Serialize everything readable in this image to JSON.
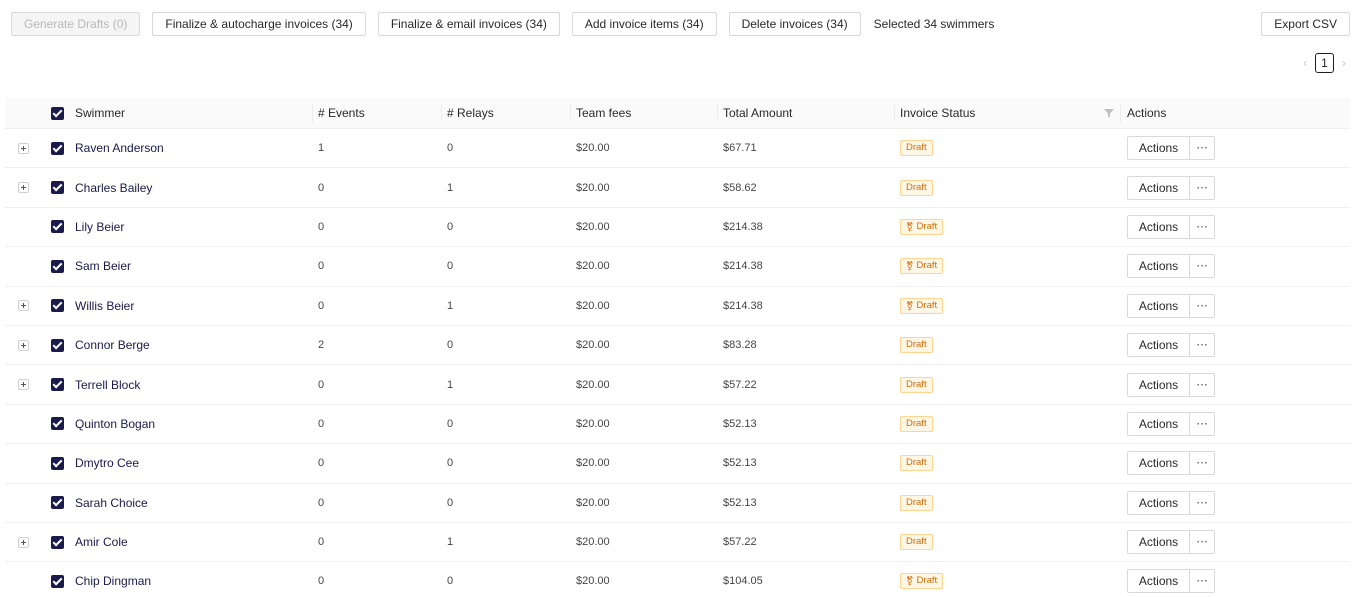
{
  "toolbar": {
    "generate_drafts": "Generate Drafts (0)",
    "finalize_autocharge": "Finalize & autocharge invoices (34)",
    "finalize_email": "Finalize & email invoices (34)",
    "add_items": "Add invoice items (34)",
    "delete_invoices": "Delete invoices (34)",
    "selected_text": "Selected 34 swimmers",
    "export_csv": "Export CSV"
  },
  "pagination": {
    "prev": "‹",
    "current_page": "1",
    "next": "›"
  },
  "table": {
    "columns": {
      "swimmer": "Swimmer",
      "events": "# Events",
      "relays": "# Relays",
      "team_fees": "Team fees",
      "total_amount": "Total Amount",
      "invoice_status": "Invoice Status",
      "actions": "Actions"
    },
    "rows": [
      {
        "expandable": true,
        "name": "Raven Anderson",
        "events": "1",
        "relays": "0",
        "fees": "$20.00",
        "total": "$67.71",
        "status": "Draft",
        "status_icon": false,
        "action": "Actions",
        "more": "···"
      },
      {
        "expandable": true,
        "name": "Charles Bailey",
        "events": "0",
        "relays": "1",
        "fees": "$20.00",
        "total": "$58.62",
        "status": "Draft",
        "status_icon": false,
        "action": "Actions",
        "more": "···"
      },
      {
        "expandable": false,
        "name": "Lily Beier",
        "events": "0",
        "relays": "0",
        "fees": "$20.00",
        "total": "$214.38",
        "status": "Draft",
        "status_icon": true,
        "action": "Actions",
        "more": "···"
      },
      {
        "expandable": false,
        "name": "Sam Beier",
        "events": "0",
        "relays": "0",
        "fees": "$20.00",
        "total": "$214.38",
        "status": "Draft",
        "status_icon": true,
        "action": "Actions",
        "more": "···"
      },
      {
        "expandable": true,
        "name": "Willis Beier",
        "events": "0",
        "relays": "1",
        "fees": "$20.00",
        "total": "$214.38",
        "status": "Draft",
        "status_icon": true,
        "action": "Actions",
        "more": "···"
      },
      {
        "expandable": true,
        "name": "Connor Berge",
        "events": "2",
        "relays": "0",
        "fees": "$20.00",
        "total": "$83.28",
        "status": "Draft",
        "status_icon": false,
        "action": "Actions",
        "more": "···"
      },
      {
        "expandable": true,
        "name": "Terrell Block",
        "events": "0",
        "relays": "1",
        "fees": "$20.00",
        "total": "$57.22",
        "status": "Draft",
        "status_icon": false,
        "action": "Actions",
        "more": "···"
      },
      {
        "expandable": false,
        "name": "Quinton Bogan",
        "events": "0",
        "relays": "0",
        "fees": "$20.00",
        "total": "$52.13",
        "status": "Draft",
        "status_icon": false,
        "action": "Actions",
        "more": "···"
      },
      {
        "expandable": false,
        "name": "Dmytro Cee",
        "events": "0",
        "relays": "0",
        "fees": "$20.00",
        "total": "$52.13",
        "status": "Draft",
        "status_icon": false,
        "action": "Actions",
        "more": "···"
      },
      {
        "expandable": false,
        "name": "Sarah Choice",
        "events": "0",
        "relays": "0",
        "fees": "$20.00",
        "total": "$52.13",
        "status": "Draft",
        "status_icon": false,
        "action": "Actions",
        "more": "···"
      },
      {
        "expandable": true,
        "name": "Amir Cole",
        "events": "0",
        "relays": "1",
        "fees": "$20.00",
        "total": "$57.22",
        "status": "Draft",
        "status_icon": false,
        "action": "Actions",
        "more": "···"
      },
      {
        "expandable": false,
        "name": "Chip Dingman",
        "events": "0",
        "relays": "0",
        "fees": "$20.00",
        "total": "$104.05",
        "status": "Draft",
        "status_icon": true,
        "action": "Actions",
        "more": "···"
      }
    ]
  },
  "colors": {
    "accent": "#1a1a4b",
    "draft_tag_text": "#d46b08",
    "draft_tag_bg": "#fff7e6",
    "draft_tag_border": "#ffd591"
  },
  "icons": {
    "filter": "filter-icon",
    "expand": "plus-square-icon",
    "status_person": "user-icon"
  }
}
